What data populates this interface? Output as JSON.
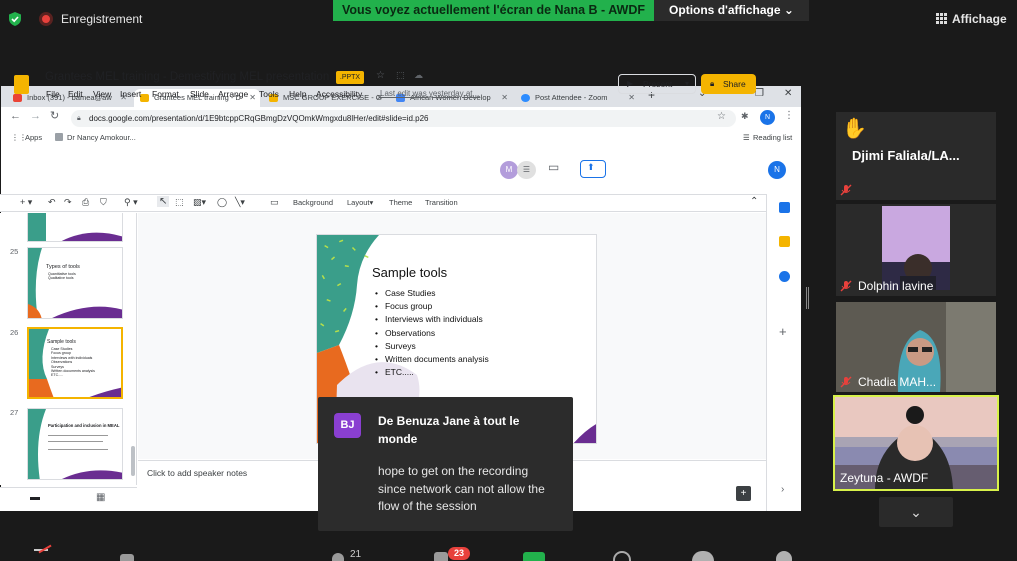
{
  "zoom": {
    "recording_label": "Enregistrement",
    "share_banner": "Vous voyez actuellement l'écran de Nana B - AWDF",
    "view_options": "Options d'affichage ⌄",
    "view_label": "Affichage",
    "chat_badge": "23",
    "participants_count": "21"
  },
  "browser": {
    "tabs": [
      {
        "label": "Inbox (391) - bamea@aw",
        "color": "#ea4335"
      },
      {
        "label": "Grantees MEL training - D",
        "color": "#f4b400"
      },
      {
        "label": "MSC GROUP EXERCISE - G",
        "color": "#f4b400"
      },
      {
        "label": "African Women Develop",
        "color": "#4285f4"
      },
      {
        "label": "Post Attendee - Zoom",
        "color": "#2d8cff"
      }
    ],
    "url": "docs.google.com/presentation/d/1E9btcppCRqGBmgDzVQOmkWmgxdu8lHer/edit#slide=id.p26",
    "bookmarks": [
      "Apps",
      "Dr Nancy Amokour..."
    ],
    "reading_list": "Reading list"
  },
  "slides_app": {
    "title": "Grantees MEL training - Demestifying MEL presentation",
    "badge": ".PPTX",
    "menu": [
      "File",
      "Edit",
      "View",
      "Insert",
      "Format",
      "Slide",
      "Arrange",
      "Tools",
      "Help",
      "Accessibility"
    ],
    "last_edit": "Last edit was yesterday at...",
    "present_label": "Present",
    "share_label": "Share",
    "user_initial": "N",
    "collab_initial": "M",
    "toolbar": {
      "background": "Background",
      "layout": "Layout▾",
      "theme": "Theme",
      "transition": "Transition"
    },
    "speaker_notes_placeholder": "Click to add speaker notes"
  },
  "filmstrip": [
    {
      "num": "",
      "title": "",
      "lines": []
    },
    {
      "num": "25",
      "title": "Types of tools",
      "lines": [
        "Quantitative tools",
        "",
        "Qualitative tools"
      ]
    },
    {
      "num": "26",
      "title": "Sample tools",
      "lines": [
        "Case Studies",
        "Focus group",
        "Interviews with individuals",
        "Observations",
        "Surveys",
        "Written documents analysis",
        "ETC....."
      ]
    },
    {
      "num": "27",
      "title": "Participation and inclusion in MEAL",
      "lines": [
        "",
        "",
        "",
        ""
      ]
    }
  ],
  "current_slide": {
    "title": "Sample tools",
    "items": [
      "Case Studies",
      "Focus group",
      "Interviews with individuals",
      "Observations",
      "Surveys",
      "Written documents analysis",
      "ETC....."
    ]
  },
  "participants": [
    {
      "name": "Djimi  Faliala/LA...",
      "hand_raised": true
    },
    {
      "name": "Dolphin lavine",
      "hand_raised": false
    },
    {
      "name": "Chadia MAH...",
      "hand_raised": false
    },
    {
      "name": "Zeytuna - AWDF",
      "hand_raised": false
    }
  ],
  "chat": {
    "avatar": "BJ",
    "from": "De Benuza Jane à tout le monde",
    "message": "hope to get on the recording since network can not allow the flow of the session"
  }
}
